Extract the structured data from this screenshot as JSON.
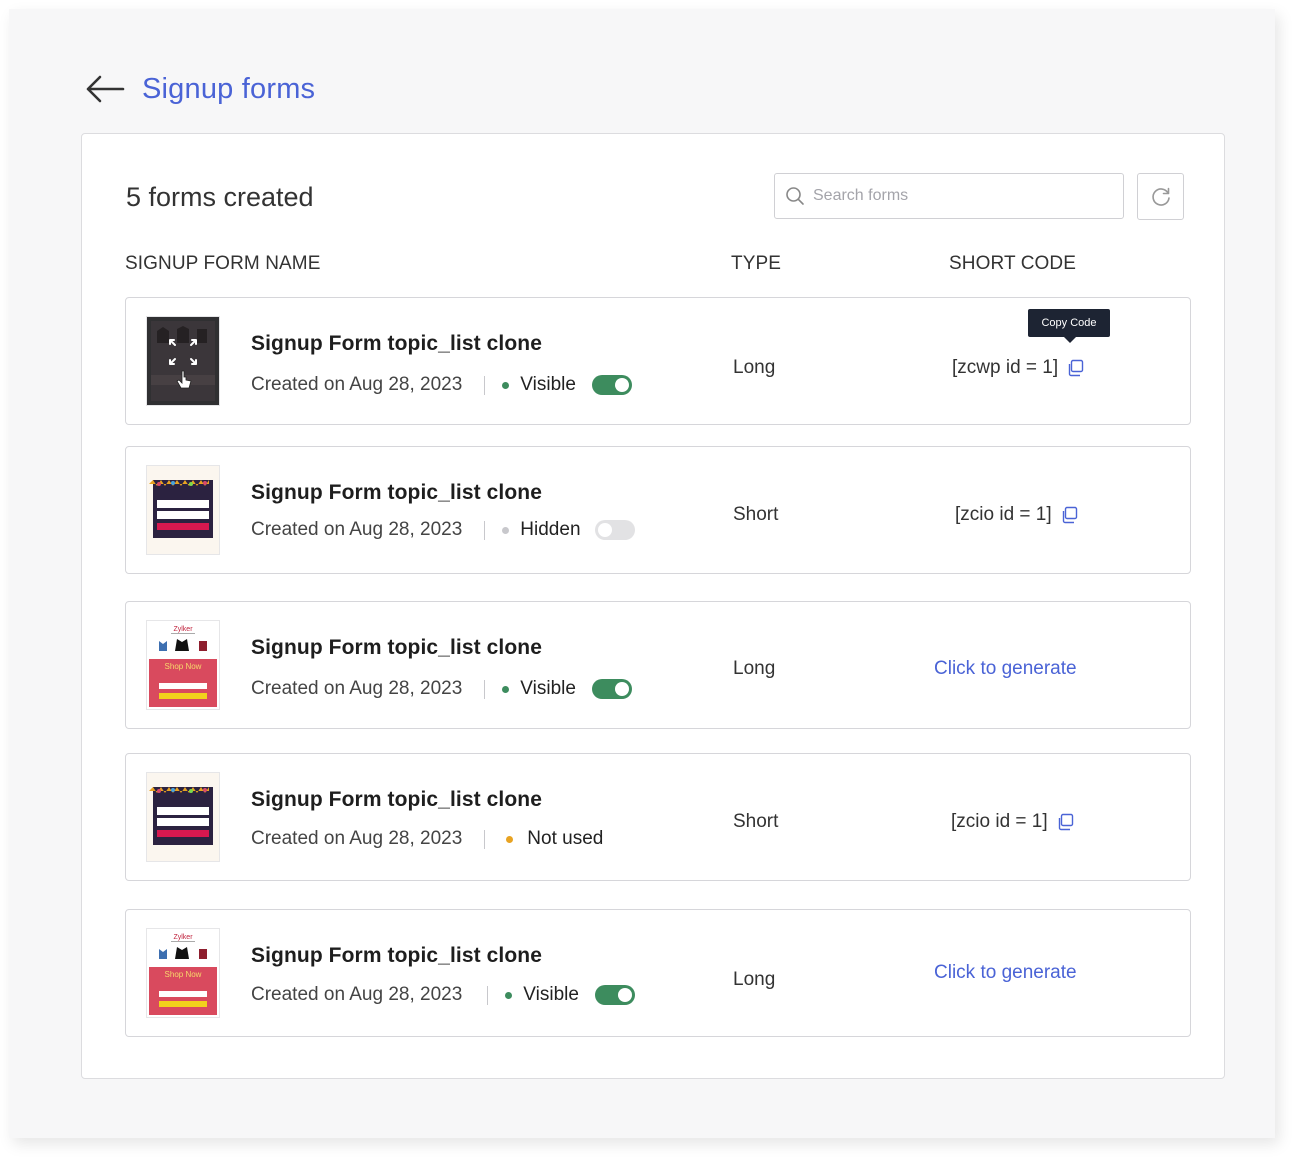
{
  "header": {
    "title": "Signup forms",
    "back_icon": "arrow-left-icon"
  },
  "summary": {
    "count_title": "5 forms created"
  },
  "search": {
    "placeholder": "Search forms",
    "value": ""
  },
  "columns": {
    "name": "SIGNUP FORM NAME",
    "type": "TYPE",
    "short_code": "SHORT CODE"
  },
  "tooltip": {
    "label": "Copy Code"
  },
  "colors": {
    "accent": "#4a63d6",
    "visible": "#3d8c5e",
    "hidden": "#c8c8cc",
    "not_used": "#e8a322"
  },
  "rows": [
    {
      "title": "Signup Form topic_list clone",
      "created": "Created on Aug 28, 2023",
      "status": "Visible",
      "toggle": "on",
      "type": "Long",
      "short_code": "[zcwp id = 1]",
      "thumb": "dark-hover"
    },
    {
      "title": "Signup Form topic_list clone",
      "created": "Created on Aug 28, 2023",
      "status": "Hidden",
      "toggle": "off",
      "type": "Short",
      "short_code": "[zcio id = 1]",
      "thumb": "navy"
    },
    {
      "title": "Signup Form topic_list clone",
      "created": "Created on Aug 28, 2023",
      "status": "Visible",
      "toggle": "on",
      "type": "Long",
      "short_code_link": "Click to generate",
      "thumb": "zylker",
      "thumb_text": {
        "brand": "Zylker",
        "cta": "Shop Now"
      }
    },
    {
      "title": "Signup Form topic_list clone",
      "created": "Created on Aug 28, 2023",
      "status": "Not used",
      "toggle": "none",
      "type": "Short",
      "short_code": "[zcio id = 1]",
      "thumb": "navy"
    },
    {
      "title": "Signup Form topic_list clone",
      "created": "Created on Aug 28, 2023",
      "status": "Visible",
      "toggle": "on",
      "type": "Long",
      "short_code_link": "Click to generate",
      "thumb": "zylker",
      "thumb_text": {
        "brand": "Zylker",
        "cta": "Shop Now"
      }
    }
  ]
}
